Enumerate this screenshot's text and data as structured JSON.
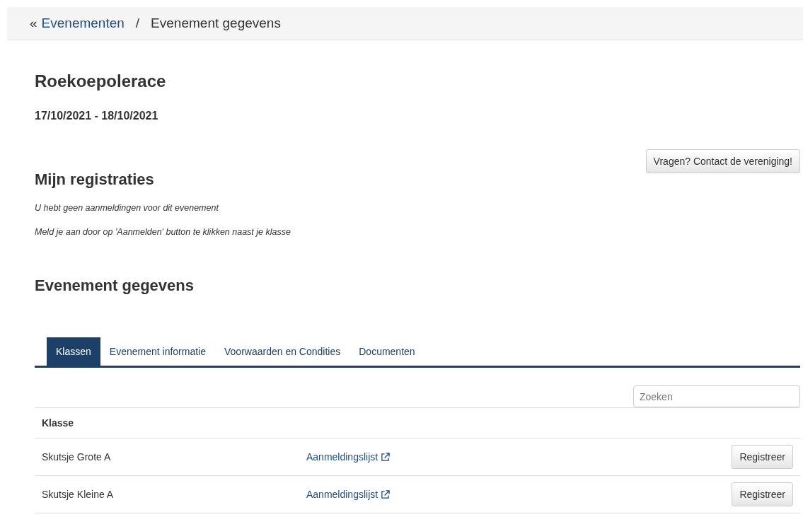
{
  "breadcrumb": {
    "separator_glyph": "«",
    "link": "Evenementen",
    "divider": "/",
    "current": "Evenement gegevens"
  },
  "event": {
    "title": "Roekoepolerace",
    "dates": "17/10/2021 - 18/10/2021"
  },
  "contact_button": "Vragen? Contact de vereniging!",
  "registrations": {
    "heading": "Mijn registraties",
    "lines": [
      "U hebt geen aanmeldingen voor dit evenement",
      "Meld je aan door op 'Aanmelden' button te klikken naast je klasse"
    ]
  },
  "details": {
    "heading": "Evenement gegevens",
    "tabs": [
      {
        "label": "Klassen",
        "selected": true
      },
      {
        "label": "Evenement informatie",
        "selected": false
      },
      {
        "label": "Voorwaarden en Condities",
        "selected": false
      },
      {
        "label": "Documenten",
        "selected": false
      }
    ],
    "search": {
      "placeholder": "Zoeken"
    },
    "table": {
      "columns": [
        "Klasse"
      ],
      "rows": [
        {
          "name": "Skutsje Grote A",
          "link": "Aanmeldingslijst",
          "button": "Registreer"
        },
        {
          "name": "Skutsje Kleine A",
          "link": "Aanmeldingslijst",
          "button": "Registreer"
        }
      ]
    }
  }
}
